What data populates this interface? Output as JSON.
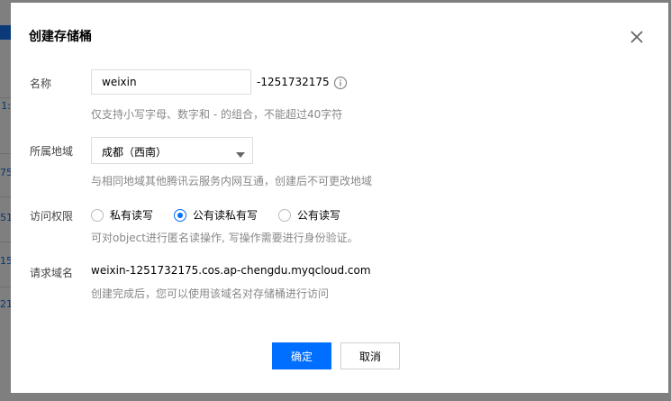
{
  "background": {
    "row_fragments": [
      "1:",
      "75",
      "51",
      "15",
      "21"
    ]
  },
  "dialog": {
    "title": "创建存储桶",
    "close_icon": "close-icon",
    "name": {
      "label": "名称",
      "value": "weixin",
      "suffix": "-1251732175",
      "info_icon": "info-circle-icon",
      "help": "仅支持小写字母、数字和 - 的组合，不能超过40字符"
    },
    "region": {
      "label": "所属地域",
      "selected": "成都（西南）",
      "caret_icon": "caret-down-icon",
      "help": "与相同地域其他腾讯云服务内网互通，创建后不可更改地域"
    },
    "access": {
      "label": "访问权限",
      "options": [
        {
          "label": "私有读写",
          "checked": false
        },
        {
          "label": "公有读私有写",
          "checked": true
        },
        {
          "label": "公有读写",
          "checked": false
        }
      ],
      "help": "可对object进行匿名读操作, 写操作需要进行身份验证。"
    },
    "domain": {
      "label": "请求域名",
      "value": "weixin-1251732175.cos.ap-chengdu.myqcloud.com",
      "help": "创建完成后，您可以使用该域名对存储桶进行访问"
    },
    "buttons": {
      "confirm": "确定",
      "cancel": "取消"
    }
  },
  "colors": {
    "accent": "#006eff",
    "overlay": "#7f7f7f"
  }
}
